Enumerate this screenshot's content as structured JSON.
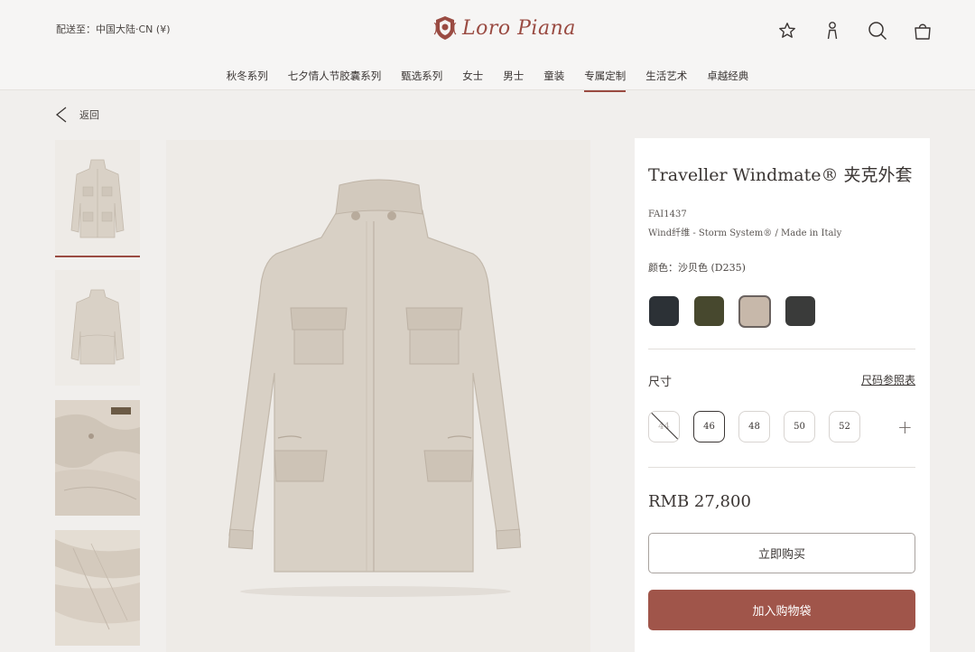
{
  "header": {
    "ship_to": "配送至：中国大陆·CN (¥)",
    "brand": "Loro Piana",
    "icons": [
      "star-icon",
      "user-icon",
      "search-icon",
      "bag-icon"
    ]
  },
  "nav": {
    "items": [
      "秋冬系列",
      "七夕情人节胶囊系列",
      "甄选系列",
      "女士",
      "男士",
      "童装",
      "专属定制",
      "生活艺术",
      "卓越经典"
    ],
    "active_index": 6
  },
  "back": {
    "label": "返回"
  },
  "product": {
    "title": "Traveller Windmate® 夹克外套",
    "code": "FAI1437",
    "description": "Wind纤维 - Storm System® / Made in Italy",
    "color_label": "颜色：沙贝色 ",
    "color_code": "(D235)",
    "swatches": [
      {
        "name": "navy",
        "color": "#2c3136"
      },
      {
        "name": "olive",
        "color": "#47482e"
      },
      {
        "name": "sand",
        "color": "#c7b8aa"
      },
      {
        "name": "charcoal",
        "color": "#3a3b3a"
      }
    ],
    "selected_swatch": 2,
    "size_label": "尺寸",
    "size_guide": "尺码参照表",
    "sizes": [
      "44",
      "46",
      "48",
      "50",
      "52"
    ],
    "selected_size": 1,
    "disabled_size": 0,
    "more_sizes": "+",
    "price": "RMB 27,800",
    "buy_now": "立即购买",
    "add_to_bag": "加入购物袋"
  },
  "colors": {
    "accent": "#9a4b42",
    "button": "#a0554a"
  }
}
